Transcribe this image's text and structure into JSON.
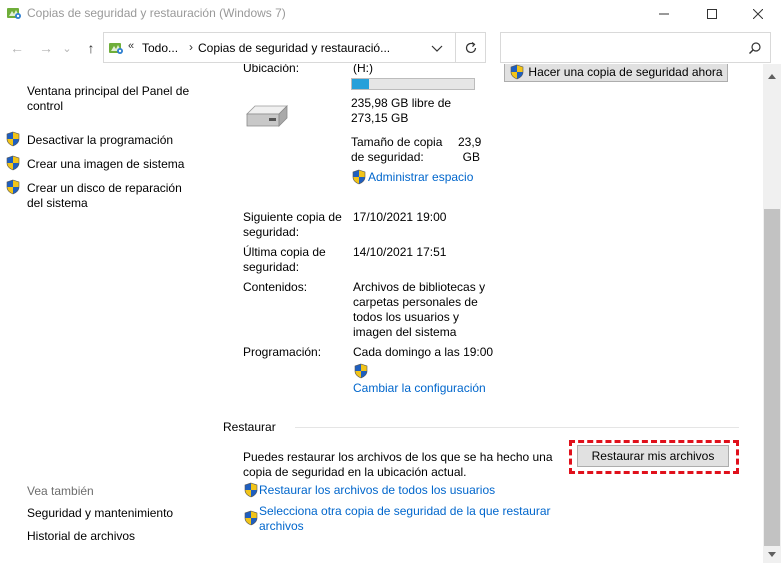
{
  "window": {
    "title": "Copias de seguridad y restauración (Windows 7)",
    "minimize": "—",
    "maximize": "☐",
    "close": "✕"
  },
  "nav": {
    "back": "←",
    "forward": "→",
    "recent": "⌄",
    "up": "↑",
    "address_prefix": "«",
    "address_part1": "Todo...",
    "address_separator": "›",
    "address_part2": "Copias de seguridad y restauració...",
    "search_placeholder": ""
  },
  "left_pane": {
    "home_link": "Ventana principal del Panel de control",
    "tasks": [
      "Desactivar la programación",
      "Crear una imagen de sistema",
      "Crear un disco de reparación del sistema"
    ],
    "see_also_heading": "Vea también",
    "see_also": [
      "Seguridad y mantenimiento",
      "Historial de archivos"
    ]
  },
  "backup": {
    "location_label": "Ubicación:",
    "location_value": "(H:)",
    "free_space": "235,98 GB libre de 273,15 GB",
    "used_fraction": 0.136,
    "size_label": "Tamaño de copia de seguridad:",
    "size_value": "23,9 GB",
    "manage_space_link": "Administrar espacio",
    "backup_now_button": "Hacer una copia de seguridad ahora",
    "next_label": "Siguiente copia de seguridad:",
    "next_value": "17/10/2021 19:00",
    "last_label": "Última copia de seguridad:",
    "last_value": "14/10/2021 17:51",
    "contents_label": "Contenidos:",
    "contents_value": "Archivos de bibliotecas y carpetas personales de todos los usuarios y imagen del sistema",
    "schedule_label": "Programación:",
    "schedule_value": "Cada domingo a las 19:00",
    "change_settings_link": "Cambiar la configuración"
  },
  "restore": {
    "heading": "Restaurar",
    "description": "Puedes restaurar los archivos de los que se ha hecho una copia de seguridad en la ubicación actual.",
    "restore_my_files_button": "Restaurar mis archivos",
    "restore_all_users_link": "Restaurar los archivos de todos los usuarios",
    "select_other_link": "Selecciona otra copia de seguridad de la que restaurar archivos"
  },
  "colors": {
    "link": "#0066cc",
    "progress_fill": "#26a0da",
    "highlight": "#e0101b"
  }
}
